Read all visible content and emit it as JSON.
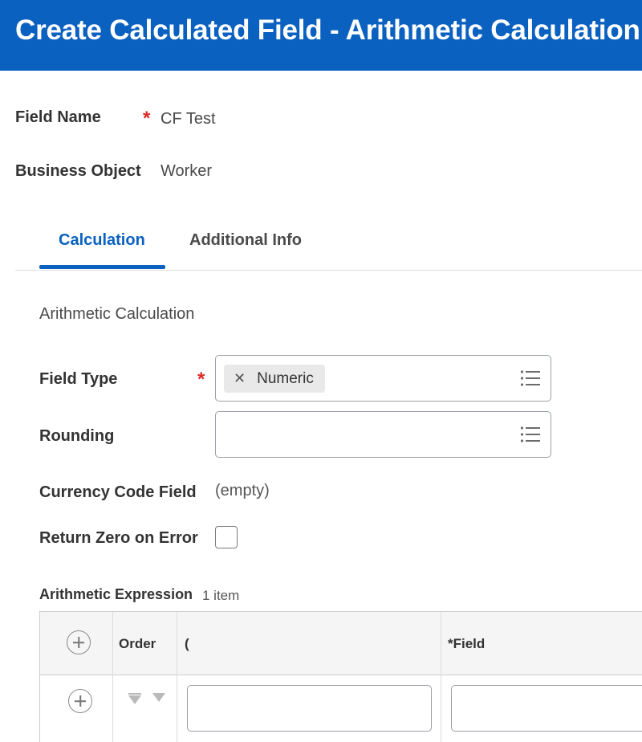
{
  "header": {
    "title": "Create Calculated Field - Arithmetic Calculation"
  },
  "form": {
    "field_name_label": "Field Name",
    "field_name_value": "CF Test",
    "required_mark": "*",
    "business_object_label": "Business Object",
    "business_object_value": "Worker"
  },
  "tabs": [
    {
      "label": "Calculation",
      "active": true
    },
    {
      "label": "Additional Info",
      "active": false
    }
  ],
  "calculation": {
    "section_title": "Arithmetic Calculation",
    "field_type_label": "Field Type",
    "field_type_value": "Numeric",
    "field_type_remove": "✕",
    "rounding_label": "Rounding",
    "currency_label": "Currency Code Field",
    "currency_value": "(empty)",
    "return_zero_label": "Return Zero on Error",
    "return_zero_checked": false
  },
  "grid": {
    "title": "Arithmetic Expression",
    "count": "1 item",
    "columns": [
      "Order",
      "(",
      "*Field"
    ]
  },
  "icons": {
    "list": "list-icon",
    "add": "add-circle-icon",
    "remove": "close-icon",
    "sort": "sort-arrow-icon"
  },
  "colors": {
    "header": "#0a61c0",
    "accent": "#0a61c0",
    "required": "#de2a2a"
  }
}
